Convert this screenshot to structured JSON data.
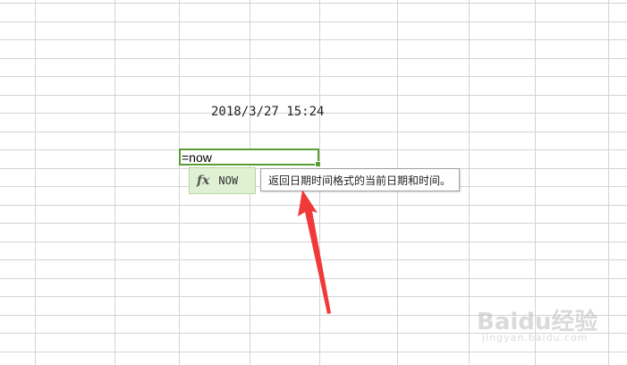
{
  "sheet": {
    "date_cell_value": "2018/3/27 15:24",
    "editing_cell_value": "=now"
  },
  "autocomplete": {
    "icon": "fx-icon",
    "function_name": "NOW"
  },
  "tooltip": {
    "text": "返回日期时间格式的当前日期和时间。"
  },
  "annotation": {
    "arrow_color": "#f03a3a"
  },
  "watermark": {
    "brand": "Baidu经验",
    "url": "jingyan.baidu.com"
  },
  "colors": {
    "gridline": "#d4d4d4",
    "active_cell_border": "#5a9e33",
    "autocomplete_bg": "#dff0d3"
  }
}
